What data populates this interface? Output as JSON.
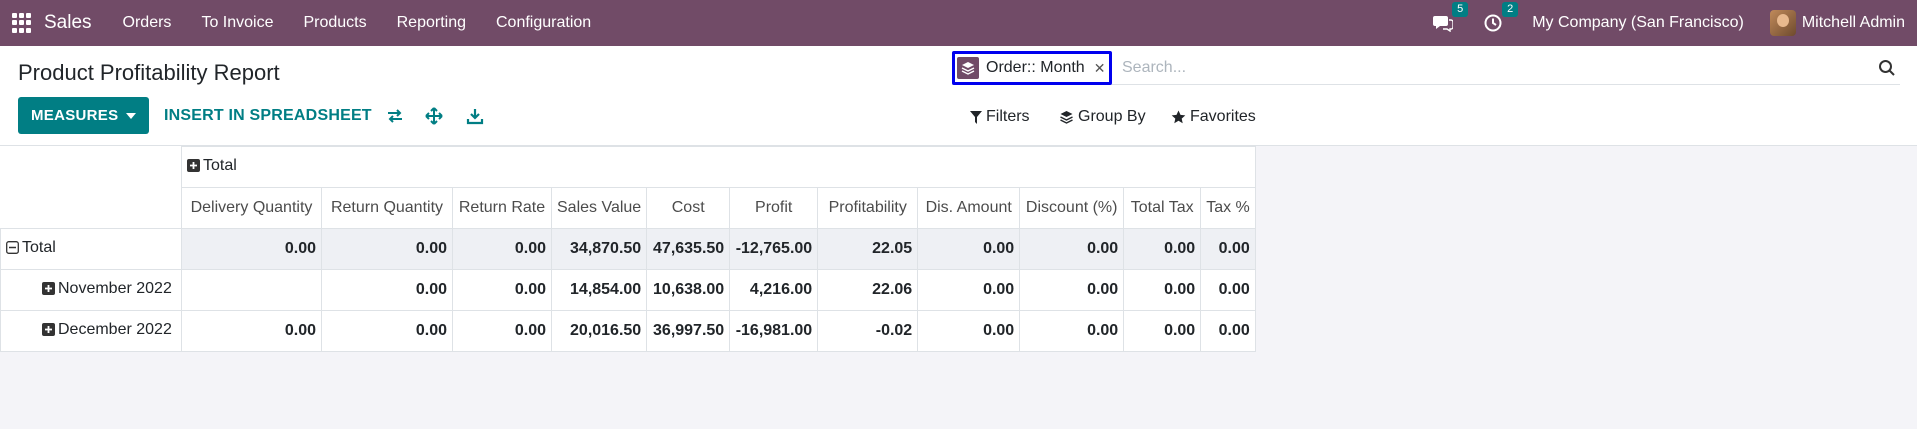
{
  "navbar": {
    "app_name": "Sales",
    "menu": [
      "Orders",
      "To Invoice",
      "Products",
      "Reporting",
      "Configuration"
    ],
    "messages_count": "5",
    "activities_count": "2",
    "company": "My Company (San Francisco)",
    "user": "Mitchell Admin"
  },
  "control_panel": {
    "title": "Product Profitability Report",
    "measures_label": "MEASURES",
    "spreadsheet_label": "INSERT IN SPREADSHEET",
    "search": {
      "facet_label": "Order:: Month",
      "placeholder": "Search..."
    },
    "filters_label": "Filters",
    "group_by_label": "Group By",
    "favorites_label": "Favorites"
  },
  "pivot": {
    "col_group_header": "Total",
    "measures": [
      "Delivery Quantity",
      "Return Quantity",
      "Return Rate",
      "Sales Value",
      "Cost",
      "Profit",
      "Profitability",
      "Dis. Amount",
      "Discount (%)",
      "Total Tax",
      "Tax %"
    ],
    "rows": [
      {
        "label": "Total",
        "values": [
          "0.00",
          "0.00",
          "0.00",
          "34,870.50",
          "47,635.50",
          "-12,765.00",
          "22.05",
          "0.00",
          "0.00",
          "0.00",
          "0.00"
        ]
      },
      {
        "label": "November 2022",
        "values": [
          "",
          "0.00",
          "0.00",
          "14,854.00",
          "10,638.00",
          "4,216.00",
          "22.06",
          "0.00",
          "0.00",
          "0.00",
          "0.00"
        ]
      },
      {
        "label": "December 2022",
        "values": [
          "0.00",
          "0.00",
          "0.00",
          "20,016.50",
          "36,997.50",
          "-16,981.00",
          "-0.02",
          "0.00",
          "0.00",
          "0.00",
          "0.00"
        ]
      }
    ]
  },
  "colors": {
    "brand": "#714b67",
    "accent": "#017e84",
    "facet_border": "#0000ee"
  }
}
